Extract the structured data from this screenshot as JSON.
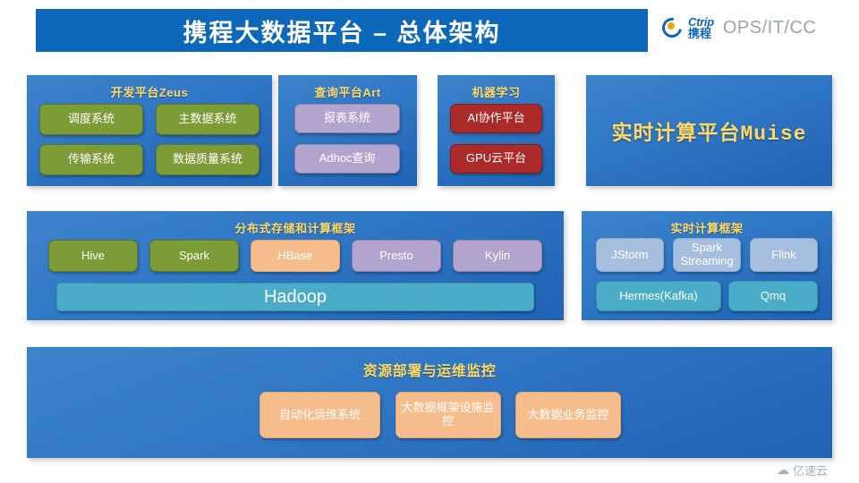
{
  "header": {
    "title": "携程大数据平台 – 总体架构",
    "brand": {
      "logo_en": "Ctrip",
      "logo_cn": "携程",
      "suffix": "OPS/IT/CC"
    },
    "bar_color": "#0e68ba"
  },
  "row1": {
    "zeus": {
      "title": "开发平台Zeus",
      "box_color": "#7d9b36",
      "boxes": [
        {
          "label": "调度系统"
        },
        {
          "label": "主数据系统"
        },
        {
          "label": "传输系统"
        },
        {
          "label": "数据质量系统"
        }
      ]
    },
    "art": {
      "title": "查询平台Art",
      "box_color": "#b3a4cd",
      "boxes": [
        {
          "label": "报表系统"
        },
        {
          "label": "Adhoc查询"
        }
      ]
    },
    "ml": {
      "title": "机器学习",
      "box_color": "#ab2b2b",
      "boxes": [
        {
          "label": "AI协作平台"
        },
        {
          "label": "GPU云平台"
        }
      ]
    },
    "muise": {
      "label": "实时计算平台Muise",
      "text_color": "#ffd966"
    }
  },
  "row2": {
    "storage": {
      "title": "分布式存储和计算框架",
      "boxes": [
        {
          "label": "Hive",
          "color": "#7d9b36"
        },
        {
          "label": "Spark",
          "color": "#7d9b36"
        },
        {
          "label": "HBase",
          "color": "#f6bd8c"
        },
        {
          "label": "Presto",
          "color": "#b3a4cd"
        },
        {
          "label": "Kylin",
          "color": "#b3a4cd"
        }
      ],
      "base_layer": {
        "label": "Hadoop",
        "color": "#4aacc8"
      }
    },
    "realtime": {
      "title": "实时计算框架",
      "engines": [
        {
          "label": "JStorm",
          "color": "#a6bfdf"
        },
        {
          "label": "Spark Streaming",
          "color": "#a6bfdf"
        },
        {
          "label": "Flink",
          "color": "#a6bfdf"
        }
      ],
      "queues": [
        {
          "label": "Hermes(Kafka)",
          "color": "#4aacc8"
        },
        {
          "label": "Qmq",
          "color": "#4aacc8"
        }
      ]
    }
  },
  "row3": {
    "ops": {
      "title": "资源部署与运维监控",
      "box_color": "#f6bd8c",
      "boxes": [
        {
          "label": "自动化运维系统"
        },
        {
          "label": "大数据框架设施监控"
        },
        {
          "label": "大数据业务监控"
        }
      ]
    }
  },
  "watermark": {
    "icon": "cloud-icon",
    "text": "亿速云"
  }
}
